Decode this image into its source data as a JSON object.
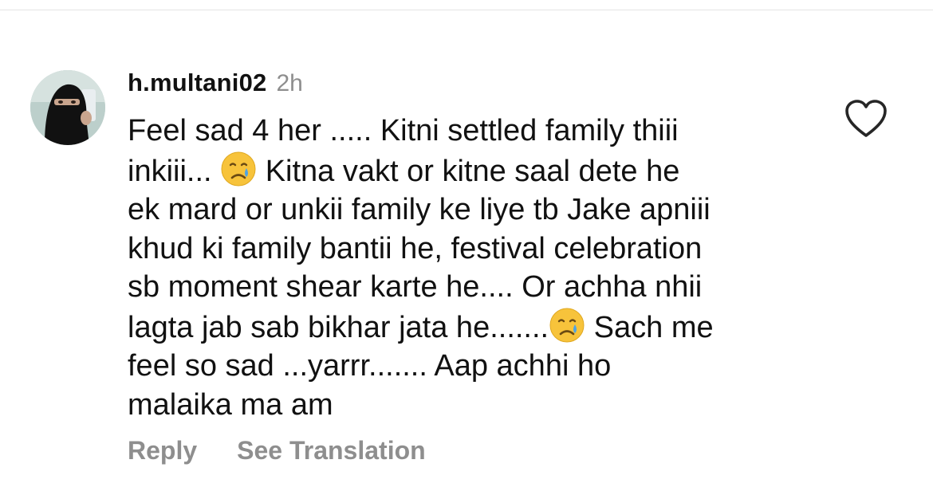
{
  "comment": {
    "username": "h.multani02",
    "timestamp": "2h",
    "line_1": "Feel sad 4 her ..... Kitni settled family thiii",
    "line_2a": "inkiii... ",
    "line_2b": " Kitna vakt or kitne saal dete he",
    "line_3": "ek mard or unkii family ke liye tb Jake apniii",
    "line_4": "khud ki family bantii he, festival celebration",
    "line_5": "sb moment shear karte he.... Or achha nhii",
    "line_6a": "lagta jab sab bikhar jata he.......",
    "line_6b": " Sach me",
    "line_7": "feel so sad ...yarrr....... Aap achhi ho",
    "line_8": "malaika ma am",
    "emoji": "crying-face"
  },
  "actions": {
    "reply_label": "Reply",
    "translate_label": "See Translation"
  },
  "icons": {
    "like": "heart-outline-icon",
    "avatar": "profile-avatar"
  },
  "colors": {
    "text": "#111111",
    "muted": "#8e8e8e",
    "emoji_face": "#f7c33b",
    "emoji_tear": "#4fa3e3"
  }
}
